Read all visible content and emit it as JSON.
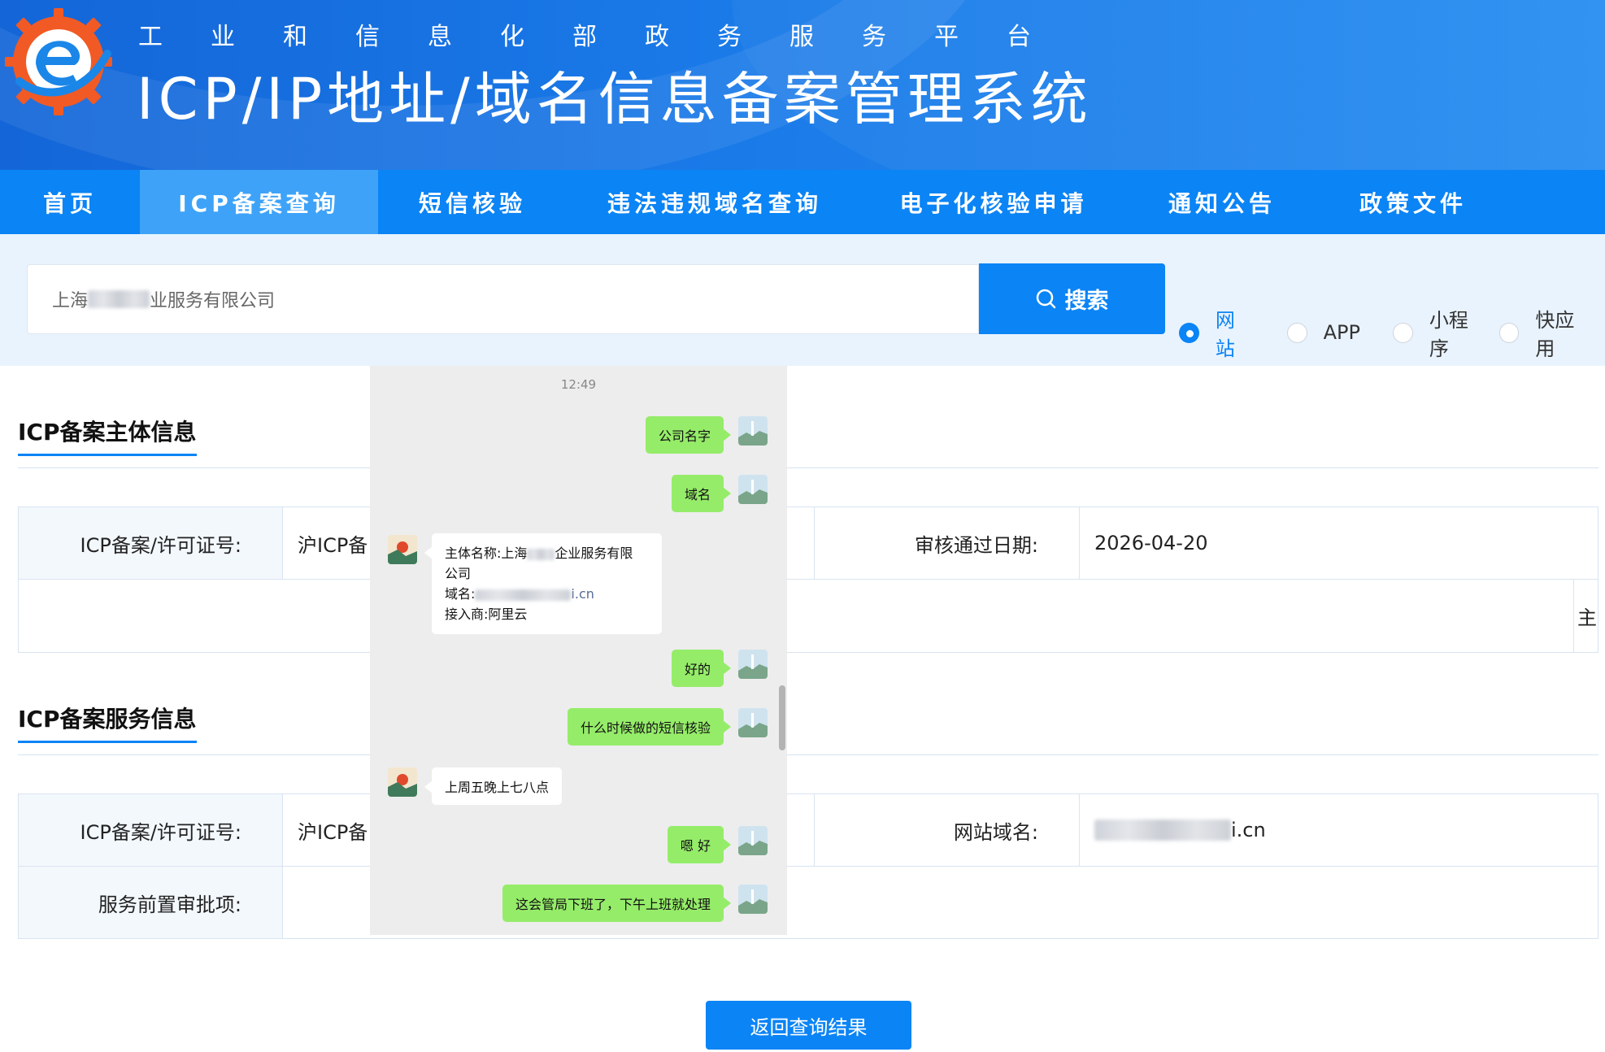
{
  "header": {
    "subtitle": "工业和信息化部政务服务平台",
    "title": "ICP/IP地址/域名信息备案管理系统"
  },
  "nav": [
    {
      "label": "首页",
      "active": false
    },
    {
      "label": "ICP备案查询",
      "active": true
    },
    {
      "label": "短信核验",
      "active": false
    },
    {
      "label": "违法违规域名查询",
      "active": false
    },
    {
      "label": "电子化核验申请",
      "active": false
    },
    {
      "label": "通知公告",
      "active": false
    },
    {
      "label": "政策文件",
      "active": false
    }
  ],
  "search": {
    "value_prefix": "上海",
    "value_suffix": "业服务有限公司",
    "button_label": "搜索",
    "types": [
      {
        "label": "网站",
        "checked": true
      },
      {
        "label": "APP",
        "checked": false
      },
      {
        "label": "小程序",
        "checked": false
      },
      {
        "label": "快应用",
        "checked": false
      }
    ]
  },
  "subject_info": {
    "title": "ICP备案主体信息",
    "license_label": "ICP备案/许可证号:",
    "license_value": "沪ICP备",
    "approval_date_label": "审核通过日期:",
    "approval_date_value": "2026-04-20",
    "edge_char": "主"
  },
  "service_info": {
    "title": "ICP备案服务信息",
    "license_label": "ICP备案/许可证号:",
    "license_value": "沪ICP备",
    "domain_label": "网站域名:",
    "domain_suffix": "i.cn",
    "preapproval_label": "服务前置审批项:"
  },
  "chat": {
    "time": "12:49",
    "messages": [
      {
        "from": "me",
        "text": "公司名字"
      },
      {
        "from": "me",
        "text": "域名"
      },
      {
        "from": "them",
        "line1_prefix": "主体名称:上海",
        "line1_suffix": "企业服务有限",
        "line2": "公司",
        "line3_label": "域名:",
        "line3_link_suffix": "i.cn",
        "line4": "接入商:阿里云"
      },
      {
        "from": "me",
        "text": "好的"
      },
      {
        "from": "me",
        "text": "什么时候做的短信核验"
      },
      {
        "from": "them",
        "text": "上周五晚上七八点"
      },
      {
        "from": "me",
        "text": "嗯 好"
      },
      {
        "from": "me",
        "text": "这会管局下班了，下午上班就处理"
      }
    ]
  },
  "back_button_label": "返回查询结果",
  "colors": {
    "brand_blue": "#0b84f5",
    "nav_active": "#3ea3f8",
    "chat_bubble_green": "#95ec69"
  }
}
